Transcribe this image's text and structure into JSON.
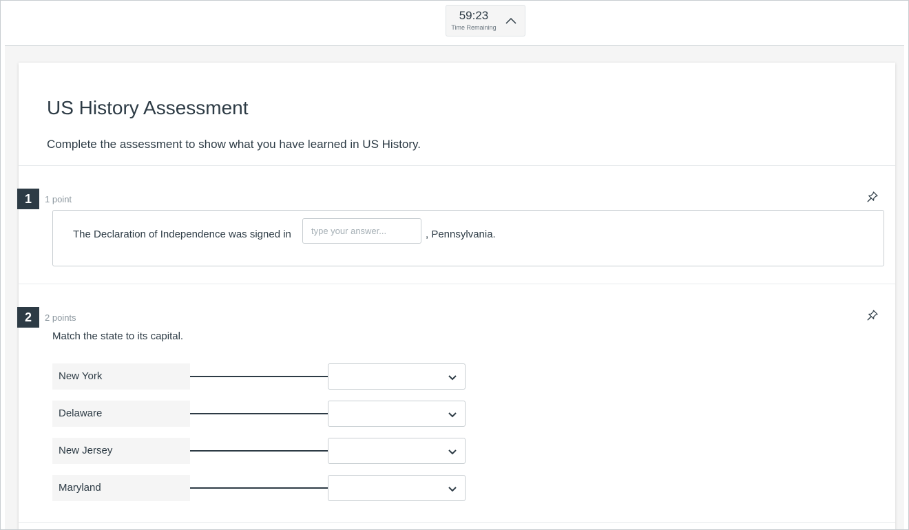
{
  "timer": {
    "value": "59:23",
    "label": "Time Remaining"
  },
  "quiz": {
    "title": "US History Assessment",
    "description": "Complete the assessment to show what you have learned in US History."
  },
  "questions": [
    {
      "number": "1",
      "points": "1 point",
      "text_before": "The Declaration of Independence was signed in",
      "input_value": "",
      "input_placeholder": "type your answer...",
      "text_after": ", Pennsylvania."
    },
    {
      "number": "2",
      "points": "2 points",
      "prompt": "Match the state to its capital.",
      "pairs": [
        {
          "state": "New York",
          "selected": ""
        },
        {
          "state": "Delaware",
          "selected": ""
        },
        {
          "state": "New Jersey",
          "selected": ""
        },
        {
          "state": "Maryland",
          "selected": ""
        }
      ]
    }
  ],
  "colors": {
    "text": "#2d3b45",
    "badge": "#2d3b45",
    "muted": "#8b969e",
    "border": "#c7cdd1",
    "label_bg": "#f5f5f5"
  },
  "icons": {
    "timer_toggle": "chevron-up-icon",
    "pin": "pin-icon",
    "select_arrow": "chevron-down-icon"
  }
}
